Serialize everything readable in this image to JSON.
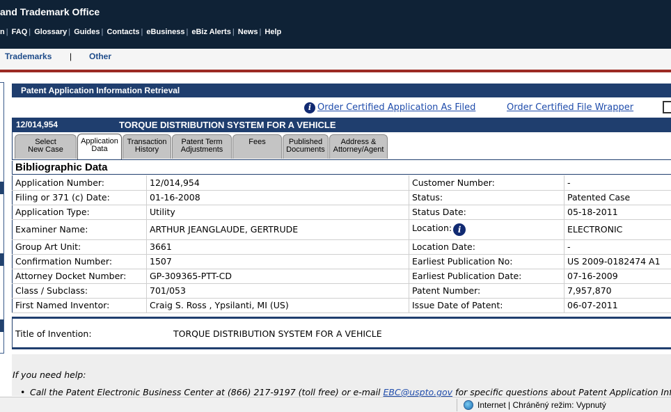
{
  "header": {
    "title": "and Trademark Office",
    "nav": [
      "n",
      "FAQ",
      "Glossary",
      "Guides",
      "Contacts",
      "eBusiness",
      "eBiz Alerts",
      "News",
      "Help"
    ]
  },
  "subnav": {
    "trademarks": "Trademarks",
    "separator": "|",
    "other": "Other"
  },
  "panel": {
    "title": "Patent Application Information Retrieval"
  },
  "orders": {
    "certified_application": "Order Certified Application As Filed",
    "certified_wrapper": "Order Certified File Wrapper"
  },
  "case": {
    "number": "12/014,954",
    "title": "TORQUE DISTRIBUTION SYSTEM FOR A VEHICLE"
  },
  "tabs": [
    {
      "line1": "Select",
      "line2": "New Case"
    },
    {
      "line1": "Application",
      "line2": "Data"
    },
    {
      "line1": "Transaction",
      "line2": "History"
    },
    {
      "line1": "Patent Term",
      "line2": "Adjustments"
    },
    {
      "line1": "Fees",
      "line2": ""
    },
    {
      "line1": "Published",
      "line2": "Documents"
    },
    {
      "line1": "Address &",
      "line2": "Attorney/Agent"
    }
  ],
  "biblio": {
    "heading": "Bibliographic Data",
    "rows": [
      {
        "l1": "Application Number:",
        "v1": "12/014,954",
        "l2": "Customer Number:",
        "v2": "-"
      },
      {
        "l1": "Filing or 371 (c) Date:",
        "v1": "01-16-2008",
        "l2": "Status:",
        "v2": "Patented Case"
      },
      {
        "l1": "Application Type:",
        "v1": "Utility",
        "l2": "Status Date:",
        "v2": "05-18-2011"
      },
      {
        "l1": "Examiner Name:",
        "v1": "ARTHUR JEANGLAUDE, GERTRUDE",
        "l2": "Location:",
        "v2": "ELECTRONIC"
      },
      {
        "l1": "Group Art Unit:",
        "v1": "3661",
        "l2": "Location Date:",
        "v2": "-"
      },
      {
        "l1": "Confirmation Number:",
        "v1": "1507",
        "l2": "Earliest Publication No:",
        "v2": "US 2009-0182474 A1"
      },
      {
        "l1": "Attorney Docket Number:",
        "v1": "GP-309365-PTT-CD",
        "l2": "Earliest Publication Date:",
        "v2": "07-16-2009"
      },
      {
        "l1": "Class / Subclass:",
        "v1": "701/053",
        "l2": "Patent Number:",
        "v2": "7,957,870"
      },
      {
        "l1": "First Named Inventor:",
        "v1": "Craig S. Ross , Ypsilanti, MI (US)",
        "l2": "Issue Date of Patent:",
        "v2": "06-07-2011"
      }
    ]
  },
  "title_of_invention": {
    "label": "Title of Invention:",
    "value": "TORQUE DISTRIBUTION SYSTEM FOR A VEHICLE"
  },
  "help": {
    "intro": "If you need help:",
    "bullet_pre": "Call the Patent Electronic Business Center at (866) 217-9197 (toll free) or e-mail ",
    "bullet_email": "EBC@uspto.gov",
    "bullet_post": " for specific questions about Patent Application Inform"
  },
  "statusbar": {
    "zone": "Internet | Chráněný režim: Vypnutý"
  },
  "icons": {
    "info": "info-icon",
    "cart": "cart-icon",
    "globe": "globe-icon"
  }
}
